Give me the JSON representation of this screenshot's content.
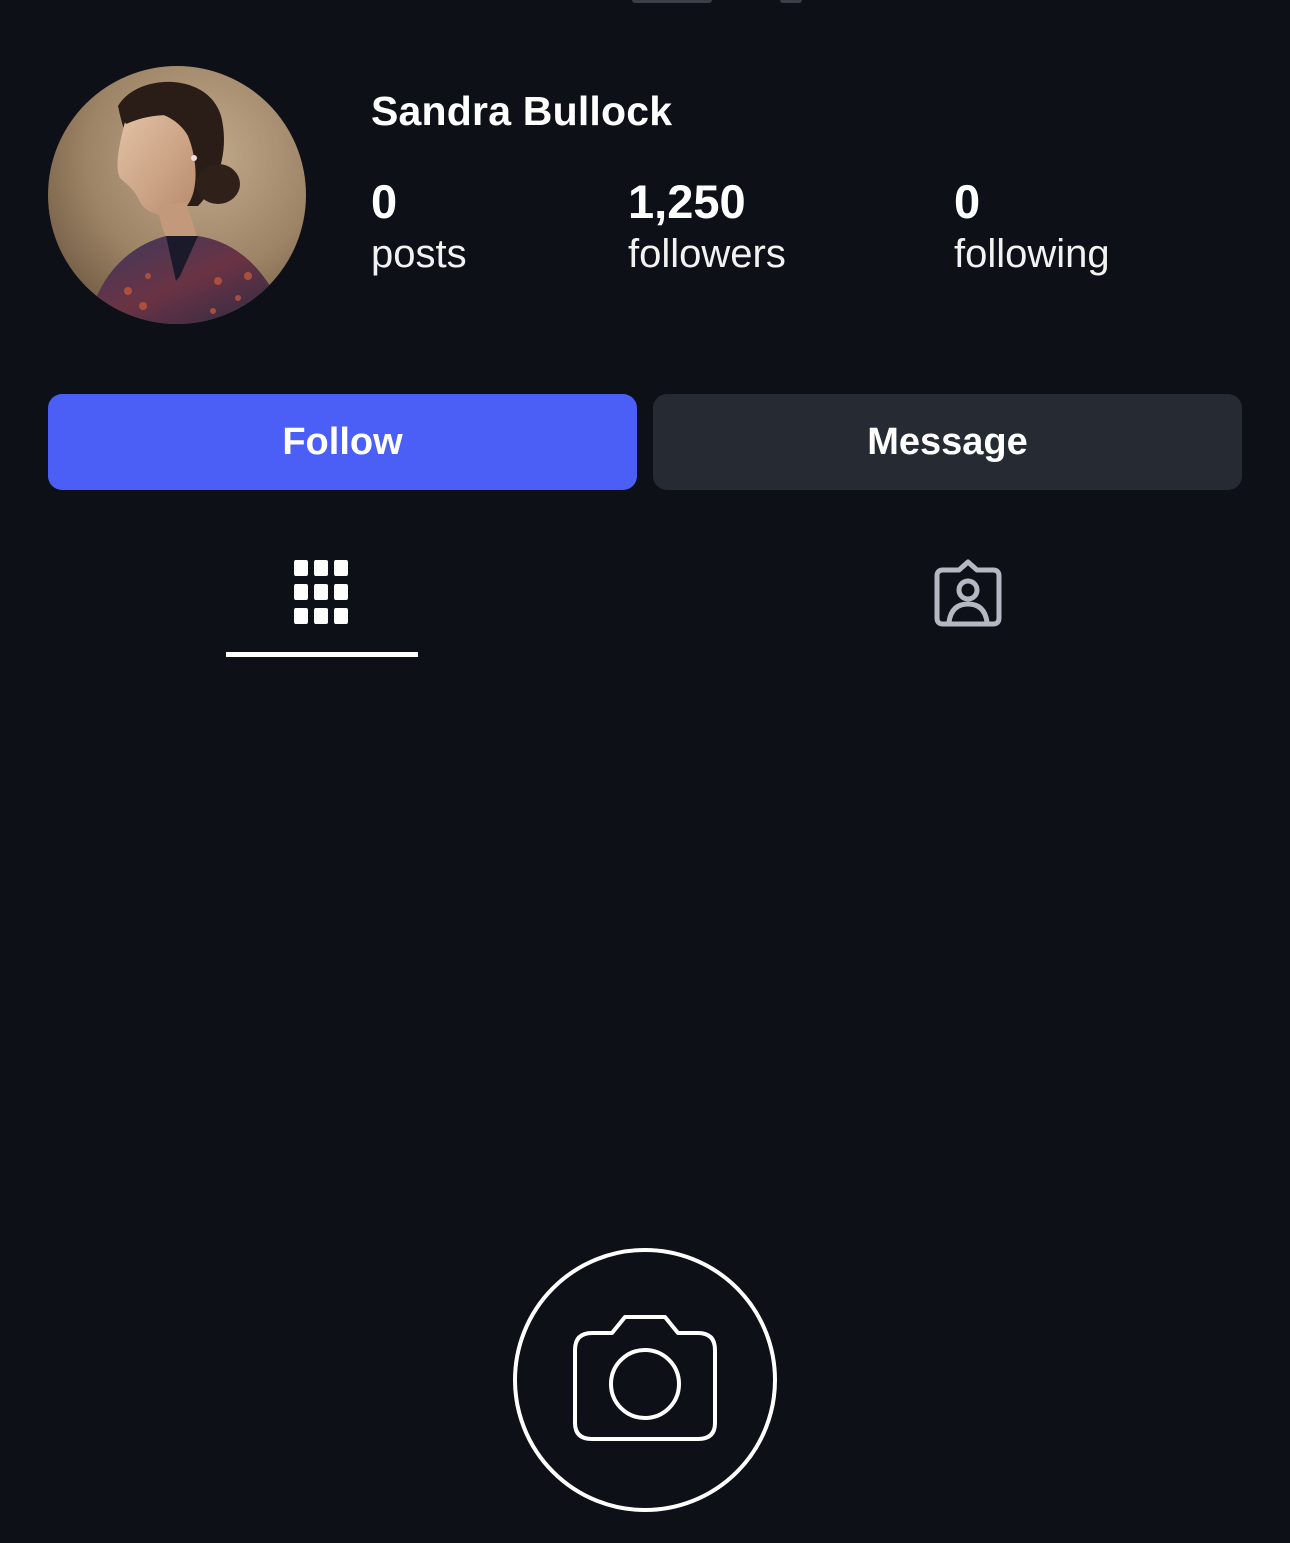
{
  "profile": {
    "name": "Sandra Bullock",
    "avatar_alt": "profile-photo"
  },
  "stats": [
    {
      "value": "0",
      "label": "posts"
    },
    {
      "value": "1,250",
      "label": "followers"
    },
    {
      "value": "0",
      "label": "following"
    }
  ],
  "actions": {
    "follow_label": "Follow",
    "message_label": "Message"
  },
  "tabs": [
    {
      "icon": "grid-icon",
      "active": true
    },
    {
      "icon": "tagged-person-icon",
      "active": false
    }
  ],
  "empty_state": {
    "icon": "camera-icon"
  },
  "colors": {
    "background": "#0d1117",
    "follow_button": "#4b5ef6",
    "message_button": "#262b33",
    "text": "#ffffff",
    "inactive_icon": "#b3b8c2"
  }
}
